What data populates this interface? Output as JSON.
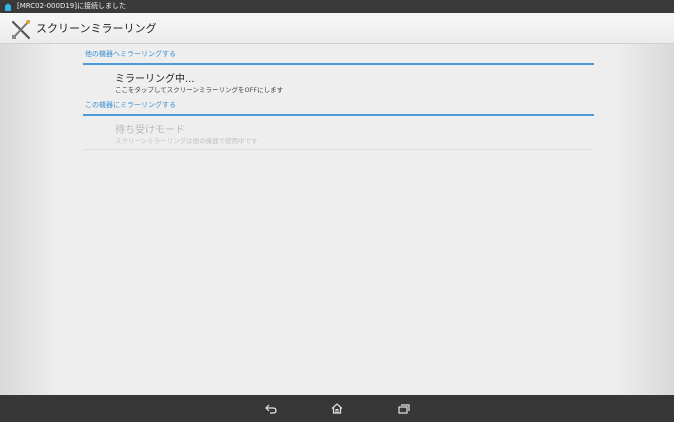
{
  "status_bar": {
    "notification_text": "[MRC02-000D19]に接続しました"
  },
  "action_bar": {
    "title": "スクリーンミラーリング"
  },
  "sections": [
    {
      "header": "他の機器へミラーリングする",
      "item": {
        "title": "ミラーリング中...",
        "subtitle": "ここをタップしてスクリーンミラーリングをOFFにします",
        "enabled": true
      }
    },
    {
      "header": "この機器にミラーリングする",
      "item": {
        "title": "待ち受けモード",
        "subtitle": "スクリーンミラーリングは他の機器で使用中です",
        "enabled": false
      }
    }
  ],
  "nav_bar": {
    "icons": [
      "back-icon",
      "home-icon",
      "recent-apps-icon"
    ]
  },
  "colors": {
    "accent": "#4f9ad6",
    "status_bar": "#3a3a3a",
    "nav_bar": "#373737"
  }
}
